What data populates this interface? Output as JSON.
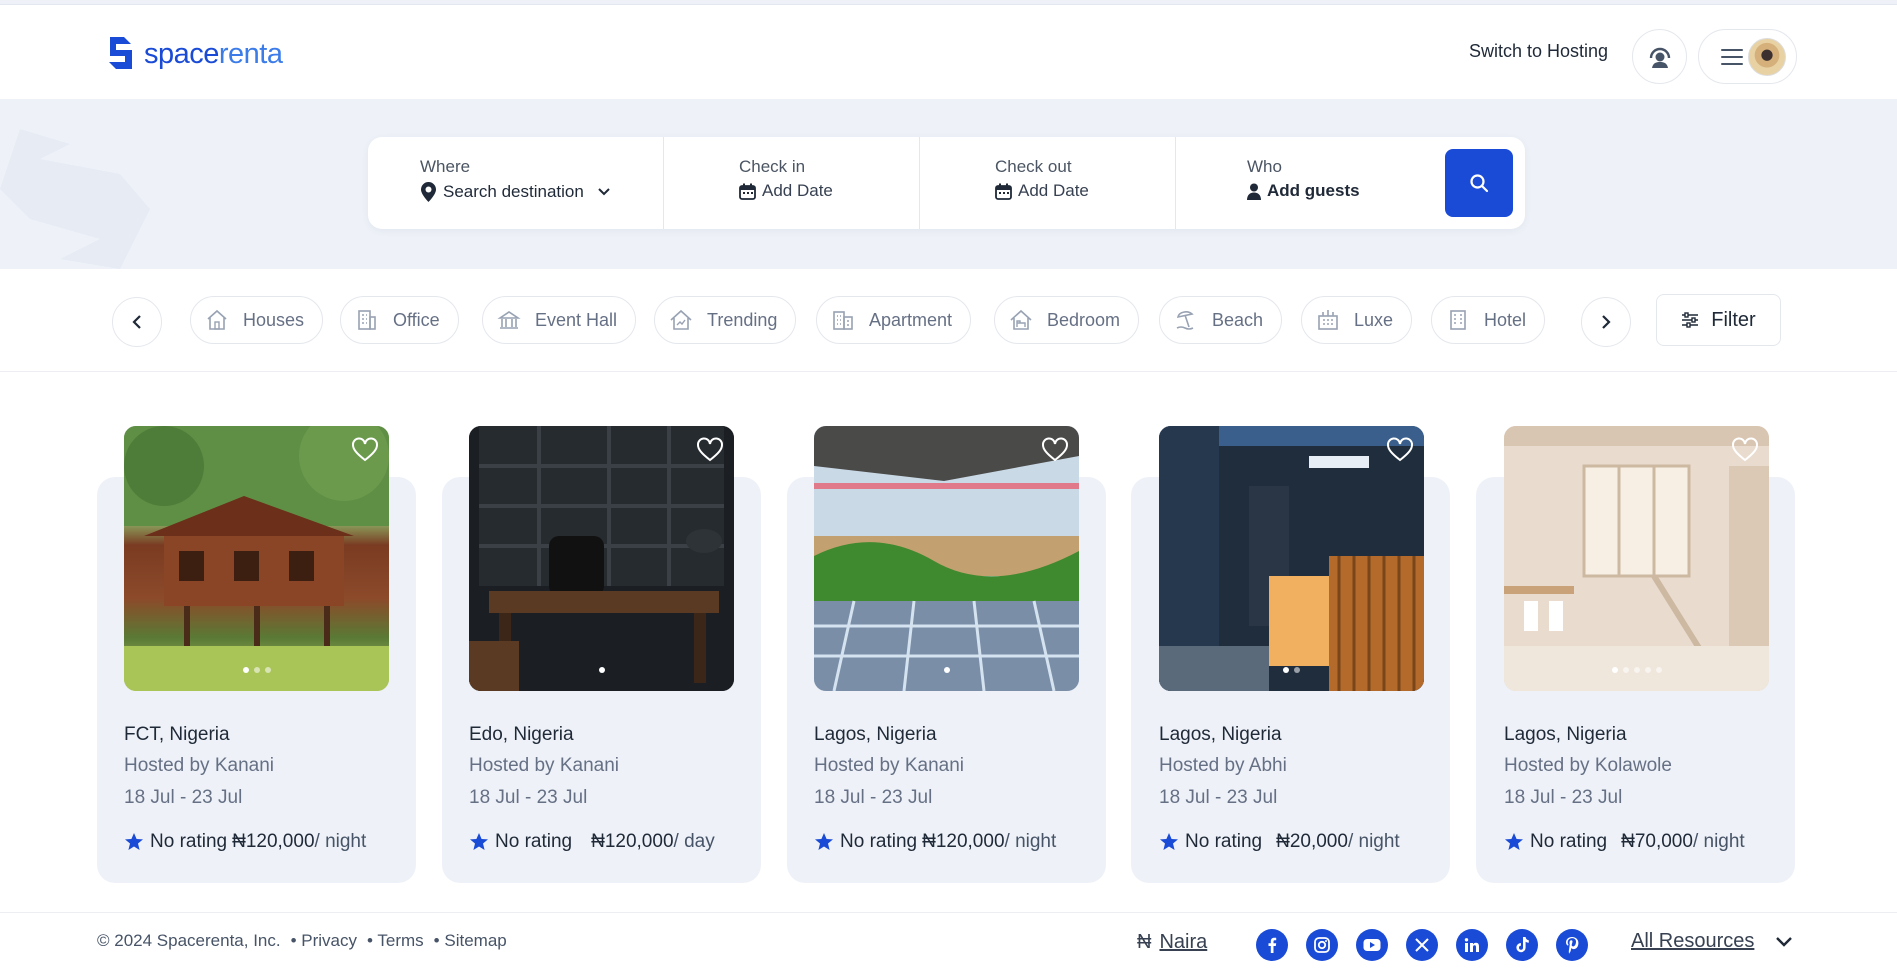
{
  "header": {
    "logo_part1": "space",
    "logo_part2": "renta",
    "switch_hosting": "Switch to Hosting"
  },
  "search": {
    "where_label": "Where",
    "where_value": "Search destination",
    "checkin_label": "Check in",
    "checkin_value": "Add Date",
    "checkout_label": "Check out",
    "checkout_value": "Add Date",
    "who_label": "Who",
    "who_value": "Add guests"
  },
  "categories": [
    {
      "label": "Houses",
      "icon": "house-icon"
    },
    {
      "label": "Office",
      "icon": "office-building-icon"
    },
    {
      "label": "Event Hall",
      "icon": "event-hall-icon"
    },
    {
      "label": "Trending",
      "icon": "trending-house-icon"
    },
    {
      "label": "Apartment",
      "icon": "apartment-icon"
    },
    {
      "label": "Bedroom",
      "icon": "bedroom-icon"
    },
    {
      "label": "Beach",
      "icon": "beach-icon"
    },
    {
      "label": "Luxe",
      "icon": "luxe-icon"
    },
    {
      "label": "Hotel",
      "icon": "hotel-icon"
    }
  ],
  "filter_label": "Filter",
  "listings": [
    {
      "location": "FCT, Nigeria",
      "host": "Hosted by Kanani",
      "dates": "18 Jul - 23 Jul",
      "rating": "No rating",
      "price": "₦120,000",
      "unit": "/ night",
      "photo": "treehouse"
    },
    {
      "location": "Edo, Nigeria",
      "host": "Hosted by Kanani",
      "dates": "18 Jul - 23 Jul",
      "rating": "No rating",
      "price": "₦120,000",
      "unit": "/ day",
      "photo": "office"
    },
    {
      "location": "Lagos, Nigeria",
      "host": "Hosted by Kanani",
      "dates": "18 Jul - 23 Jul",
      "rating": "No rating",
      "price": "₦120,000",
      "unit": "/ night",
      "photo": "garden"
    },
    {
      "location": "Lagos, Nigeria",
      "host": "Hosted by Abhi",
      "dates": "18 Jul - 23 Jul",
      "rating": "No rating",
      "price": "₦20,000",
      "unit": "/ night",
      "photo": "modern-house"
    },
    {
      "location": "Lagos, Nigeria",
      "host": "Hosted by Kolawole",
      "dates": "18 Jul - 23 Jul",
      "rating": "No rating",
      "price": "₦70,000",
      "unit": "/ night",
      "photo": "loft"
    }
  ],
  "footer": {
    "copyright": "© 2024 Spacerenta, Inc.",
    "privacy": "Privacy",
    "terms": "Terms",
    "sitemap": "Sitemap",
    "currency_symbol": "₦",
    "currency": "Naira",
    "socials": [
      "facebook-icon",
      "instagram-icon",
      "youtube-icon",
      "x-icon",
      "linkedin-icon",
      "tiktok-icon",
      "pinterest-icon"
    ],
    "resources": "All Resources"
  },
  "colors": {
    "brand": "#1a4bd6",
    "brand_light": "#3c7ce9",
    "card_bg": "#eef2f8"
  }
}
